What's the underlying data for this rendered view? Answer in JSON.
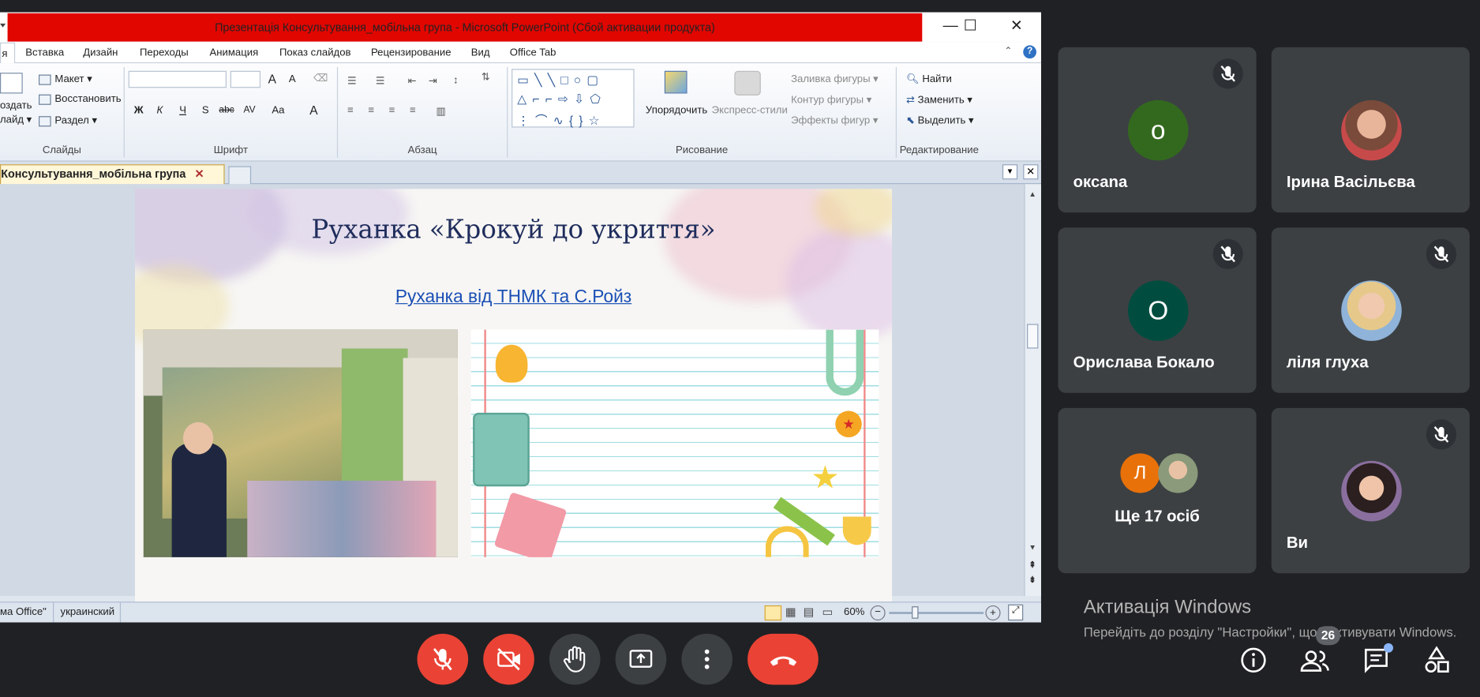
{
  "powerpoint": {
    "title": "Презентація Консультування_мобільна група  -  Microsoft PowerPoint (Сбой активации продукта)",
    "window_buttons": {
      "minimize": "—",
      "maximize": "☐",
      "close": "✕"
    },
    "tabs": [
      "я",
      "Вставка",
      "Дизайн",
      "Переходы",
      "Анимация",
      "Показ слайдов",
      "Рецензирование",
      "Вид",
      "Office Tab"
    ],
    "ribbon": {
      "slides": {
        "create": "оздать\nлайд ▾",
        "layout": "Макет ▾",
        "reset": "Восстановить",
        "section": "Раздел ▾",
        "label": "Слайды"
      },
      "font": {
        "label": "Шрифт",
        "bold": "Ж",
        "italic": "К",
        "underline": "Ч",
        "shadow": "S",
        "strike": "abc",
        "spacing": "AV",
        "case": "Aa",
        "grow": "A",
        "shrink": "A",
        "color": "A"
      },
      "paragraph": {
        "label": "Абзац"
      },
      "drawing": {
        "label": "Рисование",
        "arrange": "Упорядочить",
        "quick_styles": "Экспресс-стили",
        "fill": "Заливка фигуры ▾",
        "outline": "Контур фигуры ▾",
        "effects": "Эффекты фигур ▾"
      },
      "editing": {
        "label": "Редактирование",
        "find": "Найти",
        "replace": "Заменить ▾",
        "select": "Выделить ▾"
      }
    },
    "doc_tab": "Консультування_мобільна група",
    "slide": {
      "title": "Руханка «Крокуй до укриття»",
      "link": "Руханка від ТНМК та С.Ройз"
    },
    "status": {
      "theme": "ма Office\"",
      "language": "украинский",
      "zoom": "60%"
    }
  },
  "meet": {
    "participants": [
      {
        "name": "oксana",
        "initial": "о",
        "color": "#33691e",
        "muted": true
      },
      {
        "name": "Ірина Васільєва",
        "muted": false
      },
      {
        "name": "Орислава Бокало",
        "initial": "О",
        "color": "#004d40",
        "muted": true
      },
      {
        "name": "ліля глуха",
        "muted": true
      },
      {
        "name": "Ще 17 осіб",
        "initial": "Л",
        "color": "#e8710a",
        "muted": false
      },
      {
        "name": "Ви",
        "muted": true
      }
    ],
    "people_count": "26",
    "activation_title": "Активація Windows",
    "activation_text": "Перейдіть до розділу \"Настройки\", щоб активувати Windows."
  }
}
